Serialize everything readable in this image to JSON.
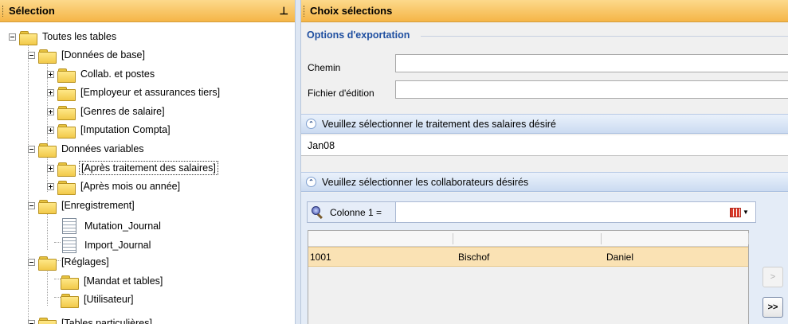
{
  "left_panel": {
    "title": "Sélection",
    "pin_glyph": "⊥",
    "tree": [
      {
        "label": "Toutes les tables",
        "icon": "folder-icon",
        "expander": "minus"
      },
      {
        "label": "[Données de base]",
        "icon": "folder-icon",
        "expander": "minus"
      },
      {
        "label": "Collab. et postes",
        "icon": "folder-icon",
        "expander": "plus"
      },
      {
        "label": "[Employeur et assurances tiers]",
        "icon": "folder-icon",
        "expander": "plus"
      },
      {
        "label": "[Genres de salaire]",
        "icon": "folder-icon",
        "expander": "plus"
      },
      {
        "label": "[Imputation Compta]",
        "icon": "folder-icon",
        "expander": "plus"
      },
      {
        "label": "Données variables",
        "icon": "folder-icon",
        "expander": "minus"
      },
      {
        "label": "[Après traitement des salaires]",
        "icon": "folder-icon",
        "expander": "plus",
        "focused": true
      },
      {
        "label": "[Après mois ou année]",
        "icon": "folder-icon",
        "expander": "plus"
      },
      {
        "label": "[Enregistrement]",
        "icon": "folder-icon",
        "expander": "minus"
      },
      {
        "label": "Mutation_Journal",
        "icon": "document-icon"
      },
      {
        "label": "Import_Journal",
        "icon": "document-icon"
      },
      {
        "label": "[Réglages]",
        "icon": "folder-icon",
        "expander": "minus"
      },
      {
        "label": "[Mandat et tables]",
        "icon": "folder-icon"
      },
      {
        "label": "[Utilisateur]",
        "icon": "folder-icon"
      },
      {
        "label": "[Tables particulières]",
        "icon": "folder-icon",
        "expander": "minus"
      }
    ]
  },
  "right_panel": {
    "title": "Choix sélections",
    "export_options": {
      "group_title": "Options d'exportation",
      "path_label": "Chemin",
      "path_value": "",
      "report_file_label": "Fichier d'édition",
      "report_file_value": ""
    },
    "salary_section": {
      "label": "Veuillez sélectionner le traitement des salaires désiré",
      "value": "Jan08"
    },
    "employees_section": {
      "label": "Veuillez sélectionner les collaborateurs désirés",
      "filter_label": "Colonne 1 =",
      "filter_value": "",
      "rows": [
        [
          "1001",
          "Bischof",
          "Daniel"
        ]
      ],
      "move_one_label": ">",
      "move_all_label": ">>"
    }
  },
  "colors": {
    "header_orange": "#f5b547",
    "section_blue": "#cbdbf1",
    "selected_row": "#fae2b4",
    "group_title_blue": "#1f4fa0"
  }
}
